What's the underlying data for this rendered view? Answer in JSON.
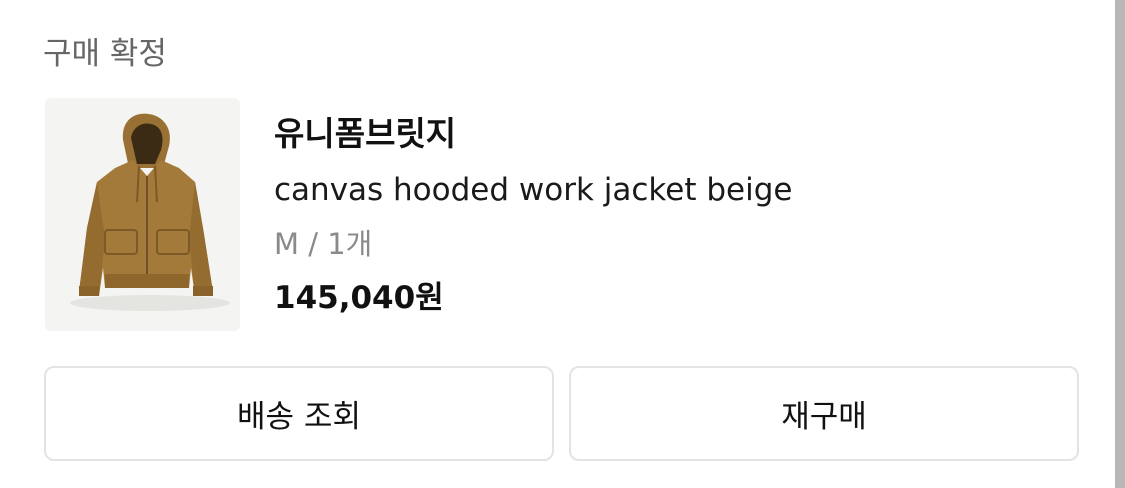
{
  "order": {
    "status": "구매 확정"
  },
  "product": {
    "brand": "유니폼브릿지",
    "name": "canvas hooded work jacket beige",
    "option": "M / 1개",
    "price": "145,040원",
    "image_icon": "hooded-jacket-image"
  },
  "actions": {
    "track_label": "배송 조회",
    "rebuy_label": "재구매"
  },
  "colors": {
    "jacket": "#a47a3a",
    "thumb_background": "#f4f4f2",
    "status_text": "#666666",
    "option_text": "#8a8a8a",
    "button_border": "#e3e3e3"
  }
}
